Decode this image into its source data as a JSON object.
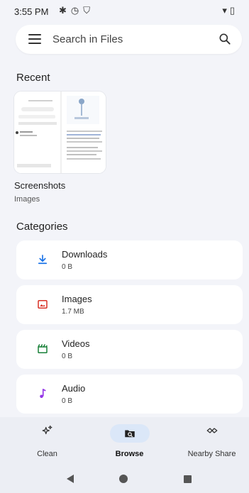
{
  "status_bar": {
    "time": "3:55 PM"
  },
  "search": {
    "placeholder": "Search in Files"
  },
  "recent": {
    "title": "Recent",
    "item": {
      "name": "Screenshots",
      "subtitle": "Images"
    }
  },
  "categories": {
    "title": "Categories",
    "items": [
      {
        "label": "Downloads",
        "size": "0 B",
        "icon": "download-icon",
        "color": "#1a73e8"
      },
      {
        "label": "Images",
        "size": "1.7 MB",
        "icon": "image-icon",
        "color": "#d93025"
      },
      {
        "label": "Videos",
        "size": "0 B",
        "icon": "video-icon",
        "color": "#188038"
      },
      {
        "label": "Audio",
        "size": "0 B",
        "icon": "audio-icon",
        "color": "#9334e6"
      }
    ]
  },
  "bottom_nav": {
    "items": [
      {
        "label": "Clean",
        "icon": "sparkle-icon"
      },
      {
        "label": "Browse",
        "icon": "browse-icon",
        "active": true
      },
      {
        "label": "Nearby Share",
        "icon": "nearby-share-icon"
      }
    ]
  }
}
